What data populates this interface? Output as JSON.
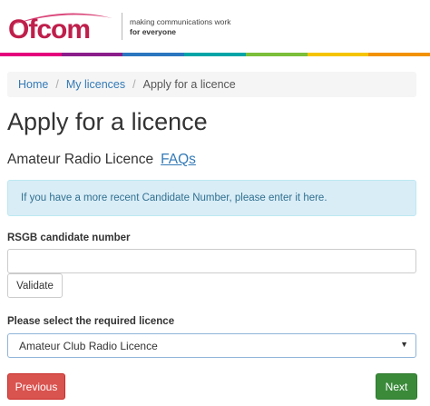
{
  "header": {
    "logo_text": "Ofcom",
    "tagline_line1": "making communications work",
    "tagline_line2": "for everyone",
    "brand_color": "#bf1f4b",
    "stripe_colors": [
      "#e4007c",
      "#8b1d8b",
      "#2a77c0",
      "#00a5a7",
      "#7bbf3a",
      "#f5c400",
      "#f29200"
    ]
  },
  "breadcrumb": {
    "items": [
      {
        "label": "Home"
      },
      {
        "label": "My licences"
      },
      {
        "label": "Apply for a licence"
      }
    ],
    "separator": "/"
  },
  "page": {
    "title": "Apply for a licence",
    "subtitle": "Amateur Radio Licence",
    "faq_link": "FAQs"
  },
  "alert": {
    "text": "If you have a more recent Candidate Number, please enter it here."
  },
  "form": {
    "candidate_label": "RSGB candidate number",
    "candidate_value": "",
    "validate_label": "Validate",
    "licence_label": "Please select the required licence",
    "licence_selected": "Amateur Club Radio Licence",
    "caret_icon": "chevron-down-icon"
  },
  "actions": {
    "previous_label": "Previous",
    "next_label": "Next"
  }
}
